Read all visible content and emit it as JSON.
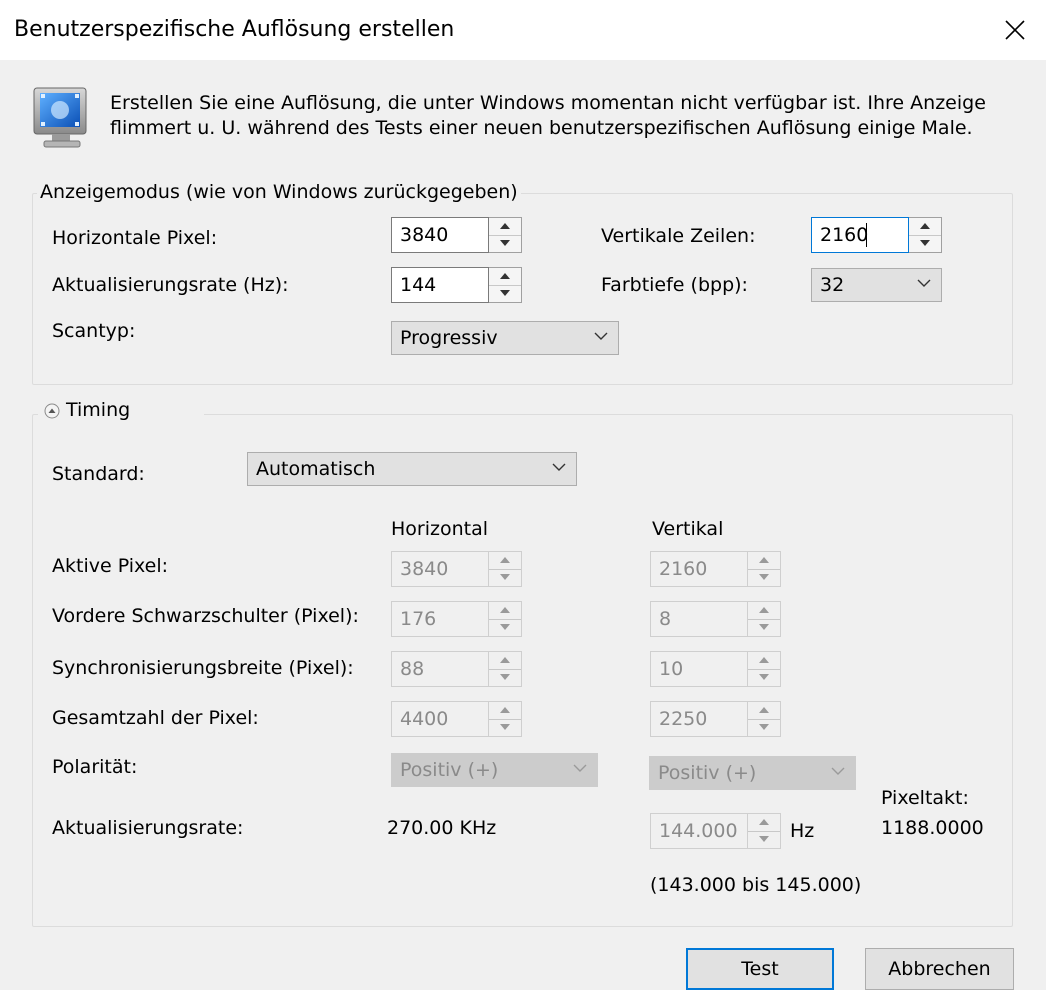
{
  "window": {
    "title": "Benutzerspezifische Auflösung erstellen"
  },
  "info": {
    "line1": "Erstellen Sie eine Auflösung, die unter Windows momentan nicht verfügbar ist. Ihre Anzeige",
    "line2": "flimmert u. U. während des Tests einer neuen benutzerspezifischen Auflösung einige Male."
  },
  "display_mode": {
    "legend": "Anzeigemodus (wie von Windows zurückgegeben)",
    "horizontal_pixels": {
      "label": "Horizontale Pixel:",
      "value": "3840"
    },
    "vertical_lines": {
      "label": "Vertikale Zeilen:",
      "value": "2160"
    },
    "refresh_rate": {
      "label": "Aktualisierungsrate (Hz):",
      "value": "144"
    },
    "color_depth": {
      "label": "Farbtiefe (bpp):",
      "value": "32"
    },
    "scan_type": {
      "label": "Scantyp:",
      "value": "Progressiv"
    }
  },
  "timing": {
    "legend": "Timing",
    "standard": {
      "label": "Standard:",
      "value": "Automatisch"
    },
    "col_horizontal": "Horizontal",
    "col_vertical": "Vertikal",
    "rows": [
      {
        "label": "Aktive Pixel:",
        "h": "3840",
        "v": "2160"
      },
      {
        "label": "Vordere Schwarzschulter (Pixel):",
        "h": "176",
        "v": "8"
      },
      {
        "label": "Synchronisierungsbreite (Pixel):",
        "h": "88",
        "v": "10"
      },
      {
        "label": "Gesamtzahl der Pixel:",
        "h": "4400",
        "v": "2250"
      }
    ],
    "polarity": {
      "label": "Polarität:",
      "h": "Positiv (+)",
      "v": "Positiv (+)"
    },
    "refresh": {
      "label": "Aktualisierungsrate:",
      "h_value": "270.00 KHz",
      "v_value": "144.000",
      "v_unit": "Hz",
      "range": "(143.000 bis 145.000)"
    },
    "pixel_clock": {
      "label": "Pixeltakt:",
      "value": "1188.0000"
    }
  },
  "buttons": {
    "test": "Test",
    "cancel": "Abbrechen"
  },
  "icons": {
    "monitor": "monitor-icon",
    "close": "close-icon",
    "collapse": "collapse-icon"
  },
  "colors": {
    "accent": "#0078d7",
    "dialog_bg": "#f0f0f0",
    "titlebar_bg": "#ffffff"
  }
}
